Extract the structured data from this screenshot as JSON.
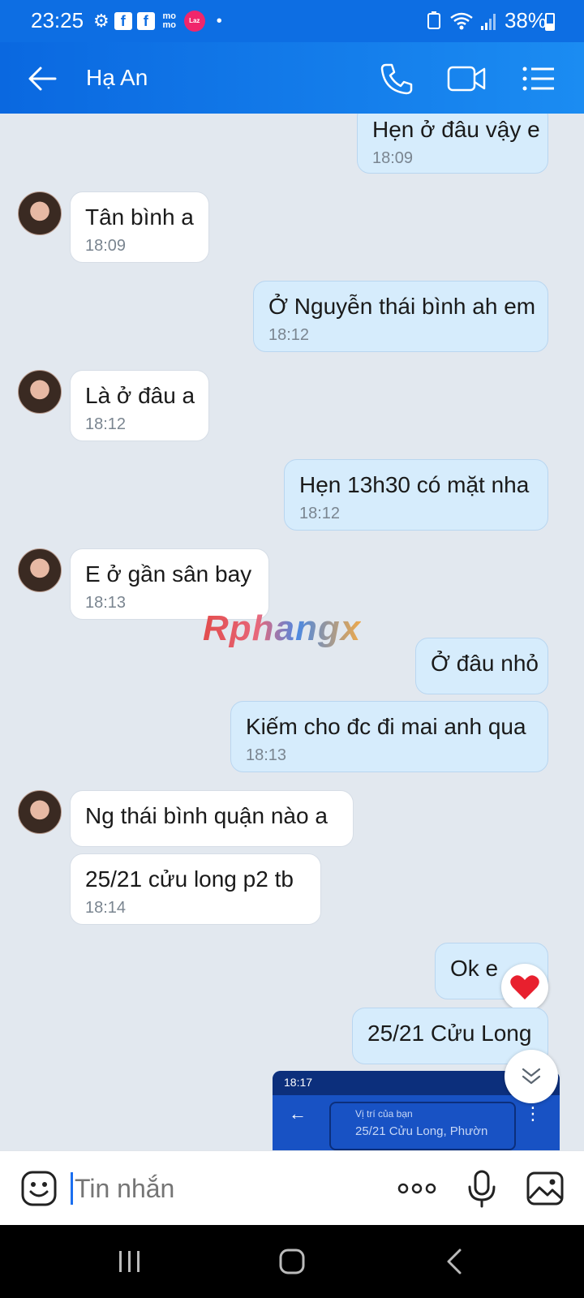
{
  "status_bar": {
    "time": "23:25",
    "battery": "38%",
    "battery_level": 0.38,
    "momo_label": "mo mo",
    "lazada_label": "Laz",
    "notification_icons": [
      "gear-icon",
      "facebook-icon",
      "facebook-icon",
      "momo-icon",
      "lazada-icon"
    ]
  },
  "header": {
    "contact_name": "Hạ An"
  },
  "messages": [
    {
      "dir": "out",
      "text": "Hẹn ở đâu vậy e",
      "time": "18:09"
    },
    {
      "dir": "in",
      "text": "Tân bình a",
      "time": "18:09"
    },
    {
      "dir": "out",
      "text": "Ở Nguyễn thái bình ah em",
      "time": "18:12"
    },
    {
      "dir": "in",
      "text": "Là ở đâu a",
      "time": "18:12"
    },
    {
      "dir": "out",
      "text": "Hẹn 13h30 có mặt nha",
      "time": "18:12"
    },
    {
      "dir": "in",
      "text": "E ở gần sân bay",
      "time": "18:13"
    },
    {
      "dir": "out",
      "text": "Ở đâu nhỏ",
      "time": ""
    },
    {
      "dir": "out",
      "text": "Kiếm cho đc đi mai anh qua",
      "time": "18:13"
    },
    {
      "dir": "in",
      "text": "Ng thái bình quận nào a",
      "time": ""
    },
    {
      "dir": "in",
      "text": "25/21 cửu long p2 tb",
      "time": "18:14"
    },
    {
      "dir": "out",
      "text": "Ok e",
      "time": ""
    },
    {
      "dir": "out",
      "text": "25/21 Cửu Long",
      "time": ""
    }
  ],
  "watermark": "Rphangx",
  "shared_image": {
    "status_time": "18:17",
    "line1": "Vị trí của bạn",
    "line2": "25/21 Cửu Long, Phườn"
  },
  "input": {
    "placeholder": "Tin nhắn"
  },
  "colors": {
    "header": "#0a68e0",
    "bubble_out": "#d6ecfc",
    "bubble_in": "#ffffff",
    "chat_bg": "#e2e8ef"
  }
}
